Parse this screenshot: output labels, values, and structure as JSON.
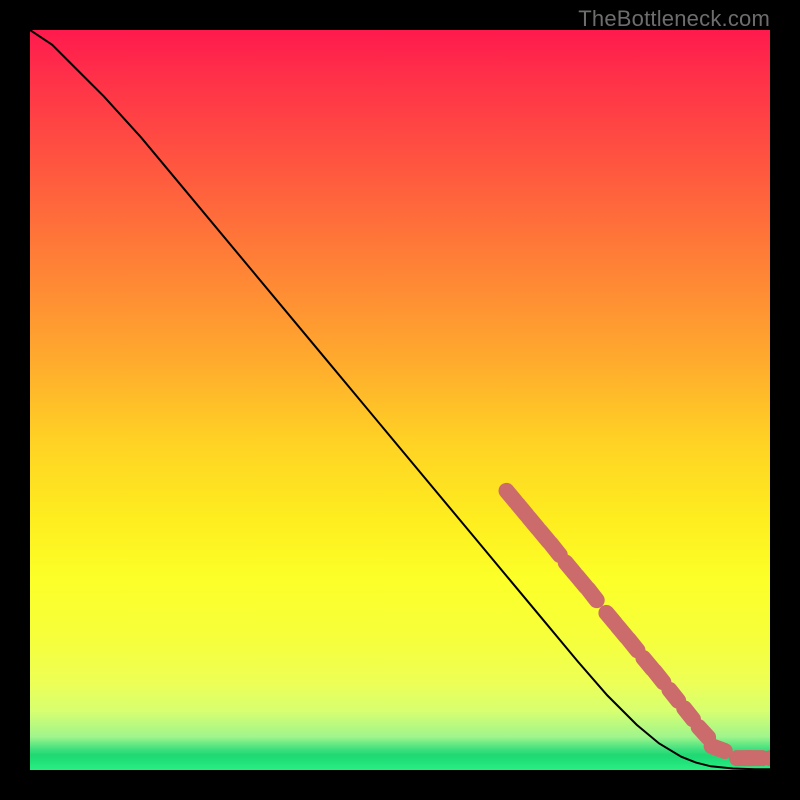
{
  "watermark": "TheBottleneck.com",
  "colors": {
    "marker": "#cc6b6b",
    "curve": "#000000",
    "frame": "#000000"
  },
  "chart_data": {
    "type": "line",
    "title": "",
    "xlabel": "",
    "ylabel": "",
    "xlim": [
      0,
      100
    ],
    "ylim": [
      0,
      100
    ],
    "grid": false,
    "legend": false,
    "series": [
      {
        "name": "curve",
        "x": [
          0,
          3,
          6,
          10,
          15,
          20,
          30,
          40,
          50,
          60,
          65,
          70,
          74,
          78,
          82,
          85,
          88,
          90,
          92,
          95,
          98,
          100
        ],
        "y": [
          100,
          98,
          95,
          91,
          85.5,
          79.5,
          67.5,
          55.5,
          43.5,
          31.5,
          25.5,
          19.5,
          14.7,
          10.1,
          6.1,
          3.6,
          1.8,
          1.0,
          0.5,
          0.2,
          0.1,
          0.1
        ]
      }
    ],
    "markers": {
      "name": "highlighted-points",
      "points": [
        {
          "x": 65.0,
          "y": 37.0
        },
        {
          "x": 66.5,
          "y": 35.2
        },
        {
          "x": 68.0,
          "y": 33.4
        },
        {
          "x": 69.5,
          "y": 31.6
        },
        {
          "x": 71.0,
          "y": 29.8
        },
        {
          "x": 73.0,
          "y": 27.3
        },
        {
          "x": 74.5,
          "y": 25.5
        },
        {
          "x": 76.0,
          "y": 23.7
        },
        {
          "x": 78.5,
          "y": 20.5
        },
        {
          "x": 80.0,
          "y": 18.7
        },
        {
          "x": 81.5,
          "y": 16.9
        },
        {
          "x": 83.5,
          "y": 14.4
        },
        {
          "x": 85.0,
          "y": 12.6
        },
        {
          "x": 87.0,
          "y": 10.1
        },
        {
          "x": 89.0,
          "y": 7.6
        },
        {
          "x": 91.0,
          "y": 5.1
        },
        {
          "x": 93.0,
          "y": 2.9
        },
        {
          "x": 96.5,
          "y": 1.6
        },
        {
          "x": 98.0,
          "y": 1.6
        },
        {
          "x": 101.0,
          "y": 1.6
        },
        {
          "x": 102.5,
          "y": 1.6
        }
      ],
      "radius": 8
    }
  }
}
